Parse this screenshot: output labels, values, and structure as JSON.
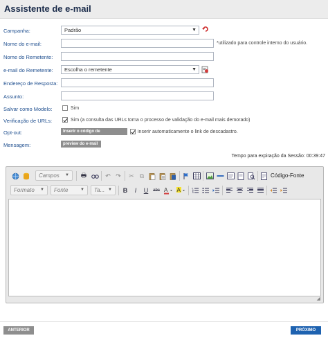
{
  "header": {
    "title": "Assistente de e-mail"
  },
  "form": {
    "campanha": {
      "label": "Campanha:",
      "value": "Padrão"
    },
    "nome_email": {
      "label": "Nome do e-mail:",
      "value": "",
      "note": "*utilizado para controle interno do usuário."
    },
    "nome_remetente": {
      "label": "Nome do Remetente:",
      "value": ""
    },
    "email_remetente": {
      "label": "e-mail do Remetente:",
      "value": "Escolha o remetente"
    },
    "endereco_resposta": {
      "label": "Endereço de Resposta:",
      "value": ""
    },
    "assunto": {
      "label": "Assunto:",
      "value": ""
    },
    "salvar_modelo": {
      "label": "Salvar como Modelo:",
      "option": "Sim",
      "checked": false
    },
    "verificacao_urls": {
      "label": "Verificação de URLs:",
      "option": "Sim (a consulta das URLs torna o processo de validação do e-mail mais demorado)",
      "checked": true
    },
    "optout": {
      "label": "Opt-out:",
      "button": "Inserir o código de descadastro",
      "option": "inserir automaticamente o link de descadastro.",
      "checked": true
    },
    "mensagem": {
      "label": "Mensagem:",
      "button": "preview do e-mail"
    }
  },
  "session": {
    "text": "Tempo para expiração da Sessão: 00:39:47"
  },
  "editor": {
    "campos": "Campos",
    "formato": "Formato",
    "fonte": "Fonte",
    "tamanho": "Ta...",
    "codigo_fonte": "Código-Fonte",
    "content": ""
  },
  "nav": {
    "prev": "ANTERIOR",
    "next": "PRÓXIMO"
  },
  "colors": {
    "label": "#1f4f8f",
    "primary": "#1e62b0",
    "gray_button": "#8e8e8e"
  }
}
